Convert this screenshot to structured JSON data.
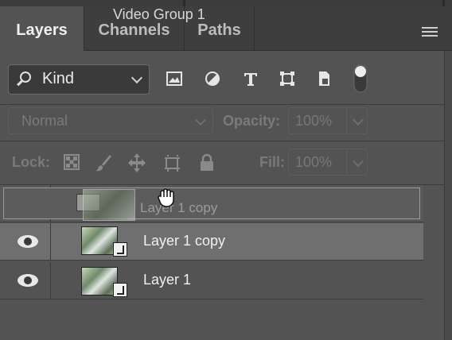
{
  "tabs": [
    {
      "label": "Layers",
      "active": true
    },
    {
      "label": "Channels",
      "active": false
    },
    {
      "label": "Paths",
      "active": false
    }
  ],
  "filter": {
    "kind_label": "Kind",
    "icons": [
      "image-filter-icon",
      "adjustment-filter-icon",
      "type-filter-icon",
      "shape-filter-icon",
      "smart-object-filter-icon",
      "filter-toggle-icon"
    ]
  },
  "blend": {
    "mode": "Normal",
    "opacity_label": "Opacity:",
    "opacity_value": "100%"
  },
  "lock": {
    "label": "Lock:",
    "icons": [
      "lock-transparent-pixels-icon",
      "lock-image-pixels-icon",
      "lock-position-icon",
      "lock-artboard-icon",
      "lock-all-icon"
    ],
    "fill_label": "Fill:",
    "fill_value": "100%"
  },
  "drag": {
    "group_name": "Video Group 1",
    "ghost_label": "Layer 1 copy"
  },
  "layers": [
    {
      "name": "Layer 1 copy",
      "selected": true
    },
    {
      "name": "Layer 1",
      "selected": false
    }
  ],
  "colors": {
    "panel": "#535353",
    "tabbar": "#3e3e3e",
    "selected_row": "#6f6f6f"
  }
}
